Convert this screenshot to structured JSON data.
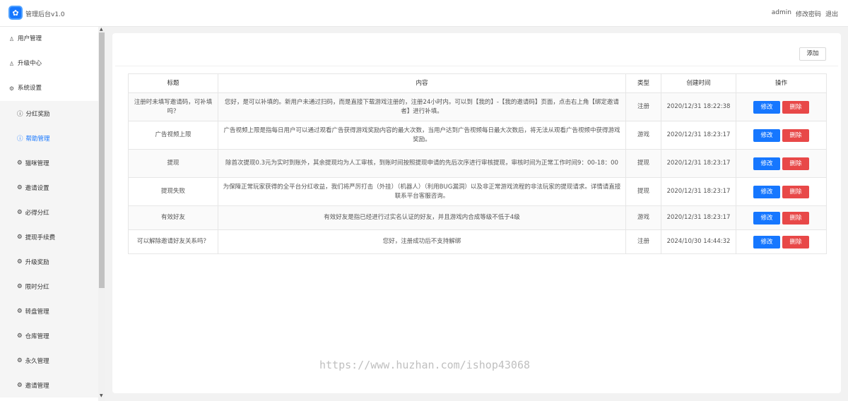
{
  "header": {
    "app_title": "管理后台v1.0",
    "user": "admin",
    "change_password": "修改密码",
    "logout": "退出"
  },
  "sidebar": {
    "items": [
      {
        "label": "用户管理",
        "icon": "user-icon"
      },
      {
        "label": "升级中心",
        "icon": "user-icon"
      },
      {
        "label": "系统设置",
        "icon": "gear-icon"
      }
    ],
    "sub_items": [
      {
        "label": "分红奖励",
        "icon": "info-circle-icon"
      },
      {
        "label": "帮助管理",
        "icon": "info-circle-icon",
        "active": true
      },
      {
        "label": "猫咪管理",
        "icon": "gear-icon"
      },
      {
        "label": "邀请设置",
        "icon": "gear-icon"
      },
      {
        "label": "必得分红",
        "icon": "gear-icon"
      },
      {
        "label": "提现手续费",
        "icon": "gear-icon"
      },
      {
        "label": "升级奖励",
        "icon": "gear-icon"
      },
      {
        "label": "限时分红",
        "icon": "gear-icon"
      },
      {
        "label": "转盘管理",
        "icon": "gear-icon"
      },
      {
        "label": "仓库管理",
        "icon": "gear-icon"
      },
      {
        "label": "永久管理",
        "icon": "gear-icon"
      },
      {
        "label": "邀请管理",
        "icon": "gear-icon"
      }
    ]
  },
  "toolbar": {
    "add_label": "添加"
  },
  "table": {
    "headers": [
      "标题",
      "内容",
      "类型",
      "创建时间",
      "操作"
    ],
    "rows": [
      {
        "title": "注册时未填写邀请码，可补填吗？",
        "content": "您好，是可以补填的。新用户未通过扫码，而是直接下载游戏注册的，注册24小时内。可以到【我的】-【我的邀请码】页面，点击右上角【绑定邀请者】进行补填。",
        "type": "注册",
        "created": "2020/12/31 18:22:38"
      },
      {
        "title": "广告视频上限",
        "content": "广告视频上限是指每日用户可以通过观看广告获得游戏奖励内容的最大次数，当用户达到广告视频每日最大次数后，将无法从观看广告视频中获得游戏奖励。",
        "type": "游戏",
        "created": "2020/12/31 18:23:17"
      },
      {
        "title": "提现",
        "content": "除首次提现0.3元为实时到账外，其余提现均为人工审核，到账时间按照提现申请的先后次序进行审核提现，审核时间为正常工作时间9：00-18：00",
        "type": "提现",
        "created": "2020/12/31 18:23:17"
      },
      {
        "title": "提现失败",
        "content": "为保障正常玩家获得的全平台分红收益，我们将严厉打击（外挂）（机器人）（利用BUG漏洞）以及非正常游戏流程的非法玩家的提现请求。详情请直接联系平台客服咨询。",
        "type": "提现",
        "created": "2020/12/31 18:23:17"
      },
      {
        "title": "有效好友",
        "content": "有效好友是指已经进行过实名认证的好友，并且游戏内合成等级不低于4级",
        "type": "游戏",
        "created": "2020/12/31 18:23:17"
      },
      {
        "title": "可以解除邀请好友关系吗？",
        "content": "您好，注册成功后不支持解绑",
        "type": "注册",
        "created": "2024/10/30 14:44:32"
      }
    ],
    "edit_label": "修改",
    "delete_label": "删除"
  },
  "watermark": "https://www.huzhan.com/ishop43068",
  "colors": {
    "primary": "#1677ff",
    "danger": "#e84848"
  }
}
